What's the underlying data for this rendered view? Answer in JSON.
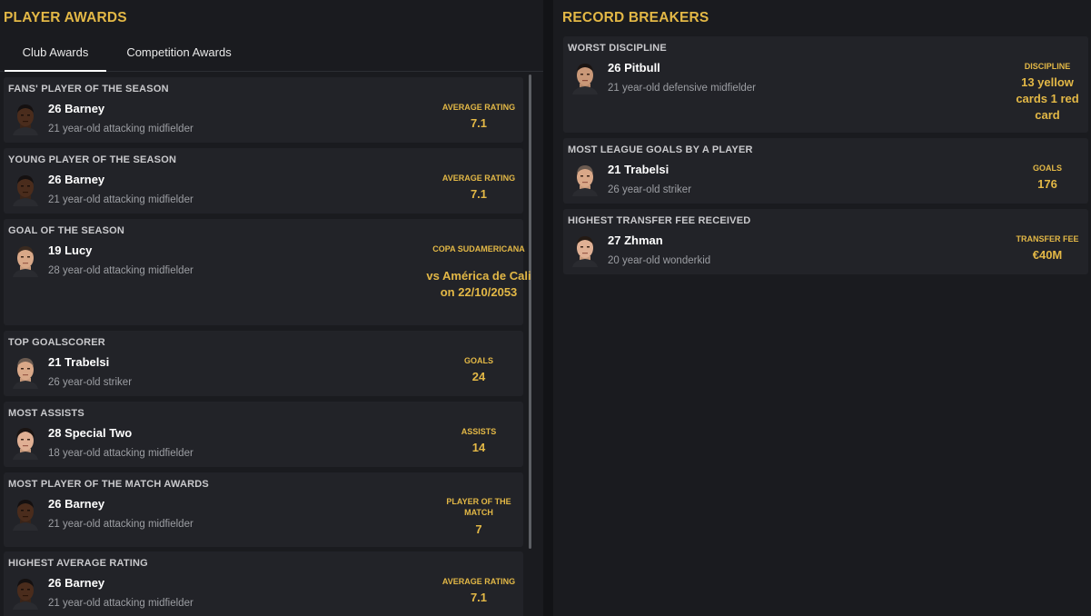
{
  "player_awards": {
    "title": "PLAYER AWARDS",
    "tabs": [
      "Club Awards",
      "Competition Awards"
    ],
    "awards": [
      {
        "title": "FANS' PLAYER OF THE SEASON",
        "player": "26 Barney",
        "description": "21 year-old attacking midfielder",
        "stat_label": "AVERAGE RATING",
        "stat_value": "7.1",
        "avatar": "dark-skin"
      },
      {
        "title": "YOUNG PLAYER OF THE SEASON",
        "player": "26 Barney",
        "description": "21 year-old attacking midfielder",
        "stat_label": "AVERAGE RATING",
        "stat_value": "7.1",
        "avatar": "dark-skin"
      },
      {
        "title": "GOAL OF THE SEASON",
        "player": "19 Lucy",
        "description": "28 year-old attacking midfielder",
        "stat_label": "COPA SUDAMERICANA",
        "stat_value": "vs América de Cali on 22/10/2053",
        "avatar": "light-skin"
      },
      {
        "title": "TOP GOALSCORER",
        "player": "21 Trabelsi",
        "description": "26 year-old striker",
        "stat_label": "GOALS",
        "stat_value": "24",
        "avatar": "light-skin"
      },
      {
        "title": "MOST ASSISTS",
        "player": "28 Special Two",
        "description": "18 year-old attacking midfielder",
        "stat_label": "ASSISTS",
        "stat_value": "14",
        "avatar": "light-skin"
      },
      {
        "title": "MOST PLAYER OF THE MATCH AWARDS",
        "player": "26 Barney",
        "description": "21 year-old attacking midfielder",
        "stat_label": "PLAYER OF THE MATCH",
        "stat_value": "7",
        "avatar": "dark-skin"
      },
      {
        "title": "HIGHEST AVERAGE RATING",
        "player": "26 Barney",
        "description": "21 year-old attacking midfielder",
        "stat_label": "AVERAGE RATING",
        "stat_value": "7.1",
        "avatar": "dark-skin"
      }
    ]
  },
  "record_breakers": {
    "title": "RECORD BREAKERS",
    "records": [
      {
        "title": "WORST DISCIPLINE",
        "player": "26 Pitbull",
        "description": "21 year-old defensive midfielder",
        "stat_label": "DISCIPLINE",
        "stat_value": "13 yellow cards 1 red card",
        "avatar": "light-skin"
      },
      {
        "title": "MOST LEAGUE GOALS BY A PLAYER",
        "player": "21 Trabelsi",
        "description": "26 year-old striker",
        "stat_label": "GOALS",
        "stat_value": "176",
        "avatar": "light-skin"
      },
      {
        "title": "HIGHEST TRANSFER FEE RECEIVED",
        "player": "27 Zhman",
        "description": "20 year-old wonderkid",
        "stat_label": "TRANSFER FEE",
        "stat_value": "€40M",
        "avatar": "light-skin"
      }
    ]
  },
  "colors": {
    "accent": "#e3b846",
    "card": "#222328",
    "panel": "#1a1b1f",
    "background": "#121316"
  }
}
